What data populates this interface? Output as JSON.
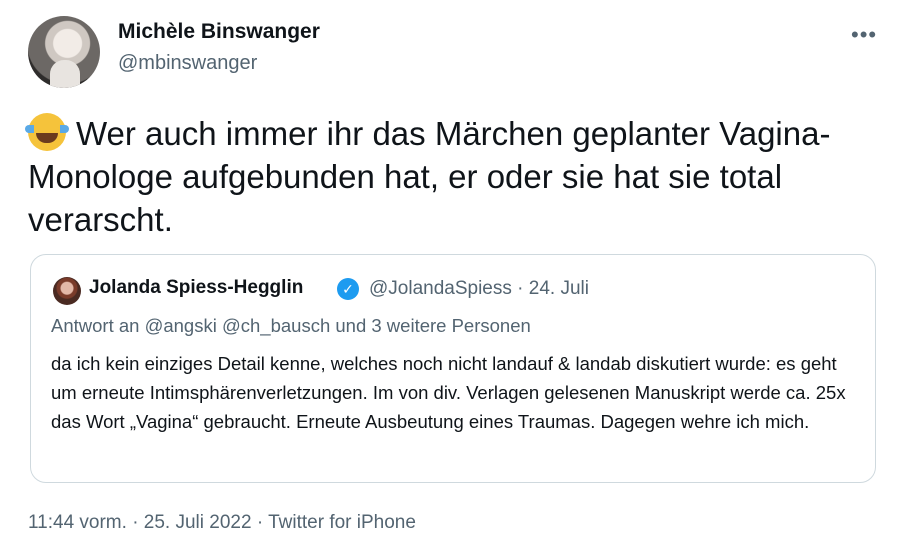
{
  "author": {
    "name": "Michèle Binswanger",
    "handle": "@mbinswanger"
  },
  "menu": {
    "more_label": "•••"
  },
  "tweet": {
    "emoji": "joy-emoji",
    "text": "Wer auch immer ihr das Märchen geplanter Vagina-Monologe aufgebunden hat, er oder sie hat sie total verarscht."
  },
  "quoted": {
    "name": "Jolanda Spiess-Hegglin",
    "verified_mark": "✓",
    "handle_date": "@JolandaSpiess · 24. Juli",
    "reply_to": "Antwort an @angski @ch_bausch und 3 weitere Personen",
    "text": "da ich kein einziges Detail kenne, welches noch nicht landauf & landab diskutiert wurde: es geht um erneute Intimsphärenverletzungen. Im von div. Verlagen gelesenen Manuskript werde ca. 25x das Wort „Vagina“ gebraucht. Erneute Ausbeutung eines Traumas. Dagegen wehre ich mich."
  },
  "footer": {
    "meta": "11:44 vorm. · 25. Juli 2022 · Twitter for iPhone"
  },
  "colors": {
    "text": "#0f1419",
    "secondary": "#536471",
    "border": "#cfd9de",
    "verified": "#1d9bf0"
  }
}
